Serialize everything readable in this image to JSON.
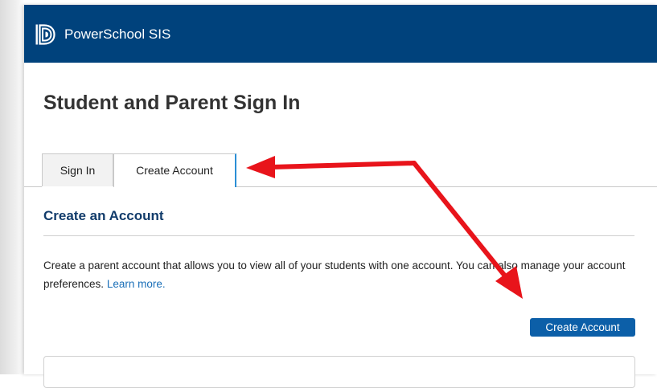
{
  "header": {
    "brand_name": "PowerSchool SIS",
    "background_color": "#00427c",
    "logo_icon": "powerschool-logo-icon"
  },
  "page": {
    "title": "Student and Parent Sign In"
  },
  "tabs": [
    {
      "label": "Sign In",
      "active": false
    },
    {
      "label": "Create Account",
      "active": true
    }
  ],
  "create_account_section": {
    "heading": "Create an Account",
    "description": "Create a parent account that allows you to view all of your students with one account. You can also manage your account preferences.",
    "learn_more_link": "Learn more.",
    "button_label": "Create Account",
    "button_color": "#0c5fa8",
    "link_color": "#1a6fb8"
  },
  "annotations": {
    "arrow_color": "#e8141b",
    "arrow_icons": [
      "red-arrow-icon",
      "red-arrow-icon"
    ]
  }
}
